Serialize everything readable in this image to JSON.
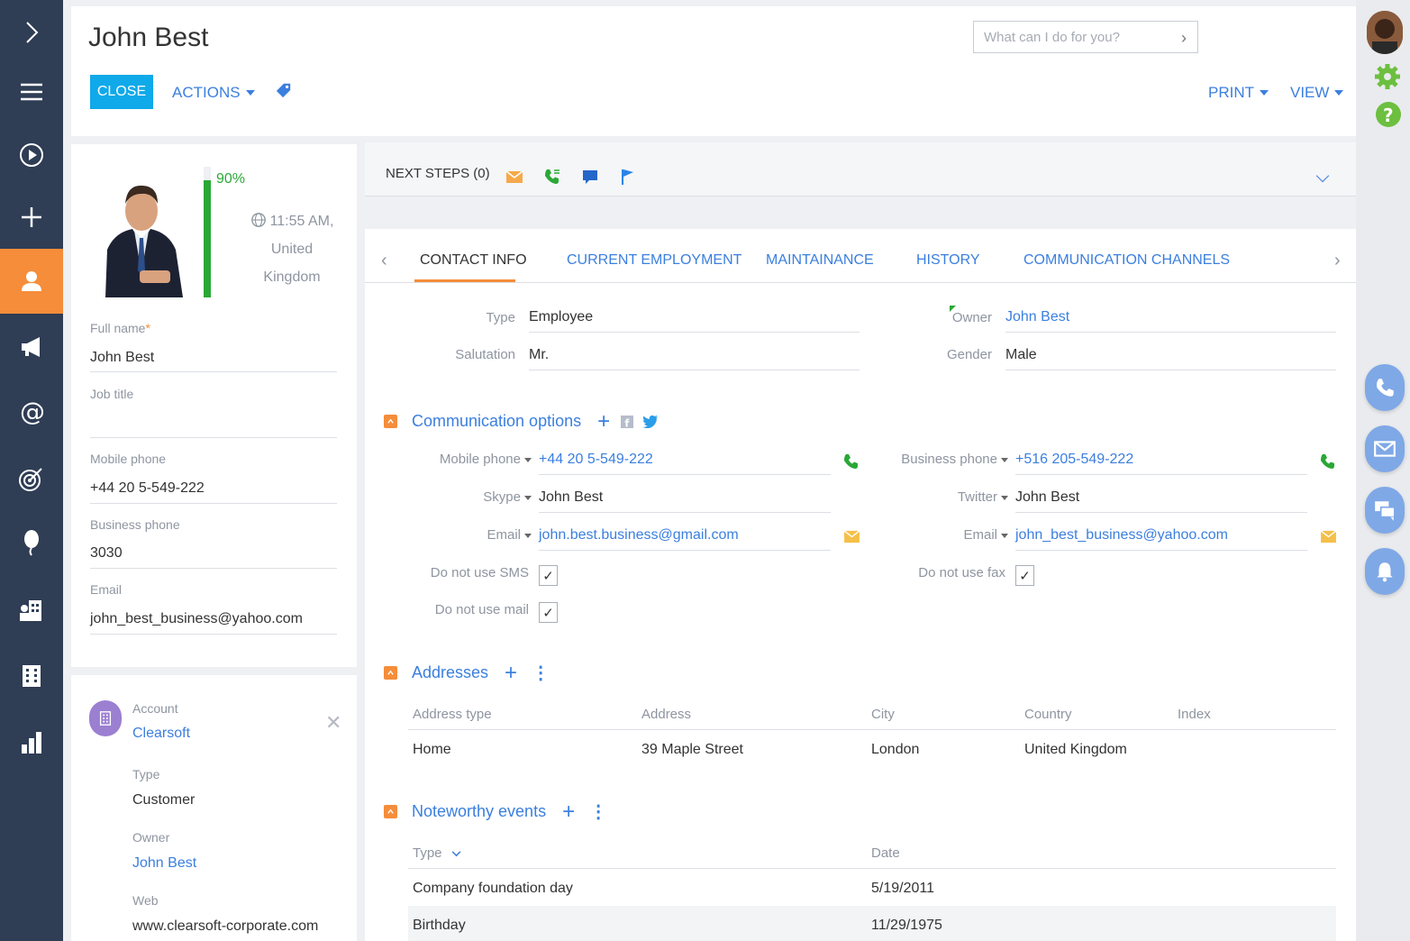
{
  "header": {
    "title": "John Best",
    "search_placeholder": "What can I do for you?",
    "close_label": "CLOSE",
    "actions_label": "ACTIONS",
    "print_label": "PRINT",
    "view_label": "VIEW"
  },
  "profile": {
    "completeness_value": 90,
    "completeness_label": "90%",
    "time_line1": "11:55 AM,",
    "time_line2": "United",
    "time_line3": "Kingdom",
    "full_name_label": "Full name",
    "full_name_required": "*",
    "full_name": "John Best",
    "job_title_label": "Job title",
    "job_title": "",
    "mobile_phone_label": "Mobile phone",
    "mobile_phone": "+44 20 5-549-222",
    "business_phone_label": "Business phone",
    "business_phone": "3030",
    "email_label": "Email",
    "email": "john_best_business@yahoo.com"
  },
  "account": {
    "account_label": "Account",
    "account_name": "Clearsoft",
    "type_label": "Type",
    "type": "Customer",
    "owner_label": "Owner",
    "owner": "John Best",
    "web_label": "Web",
    "web": "www.clearsoft-corporate.com"
  },
  "next_steps": {
    "label": "NEXT STEPS (0)"
  },
  "tabs": [
    {
      "label": "CONTACT INFO"
    },
    {
      "label": "CURRENT EMPLOYMENT"
    },
    {
      "label": "MAINTAINANCE"
    },
    {
      "label": "HISTORY"
    },
    {
      "label": "COMMUNICATION CHANNELS"
    }
  ],
  "contact_info": {
    "type_label": "Type",
    "type": "Employee",
    "salutation_label": "Salutation",
    "salutation": "Mr.",
    "owner_label": "Owner",
    "owner": "John Best",
    "gender_label": "Gender",
    "gender": "Male"
  },
  "communication": {
    "title": "Communication options",
    "mobile_label": "Mobile phone",
    "mobile": "+44 20 5-549-222",
    "skype_label": "Skype",
    "skype": "John Best",
    "email1_label": "Email",
    "email1": "john.best.business@gmail.com",
    "business_label": "Business phone",
    "business": "+516 205-549-222",
    "twitter_label": "Twitter",
    "twitter": "John Best",
    "email2_label": "Email",
    "email2": "john_best_business@yahoo.com",
    "no_sms_label": "Do not use SMS",
    "no_sms": true,
    "no_fax_label": "Do not use fax",
    "no_fax": true,
    "no_mail_label": "Do not use mail",
    "no_mail": true
  },
  "addresses": {
    "title": "Addresses",
    "columns": [
      "Address type",
      "Address",
      "City",
      "Country",
      "Index"
    ],
    "rows": [
      [
        "Home",
        "39 Maple Street",
        "London",
        "United Kingdom",
        ""
      ]
    ]
  },
  "events": {
    "title": "Noteworthy events",
    "columns": [
      "Type",
      "Date"
    ],
    "rows": [
      [
        "Company foundation day",
        "5/19/2011"
      ],
      [
        "Birthday",
        "11/29/1975"
      ]
    ]
  },
  "colors": {
    "sidebar": "#2f3d55",
    "accent_orange": "#f58d3a",
    "link_blue": "#3b7fdf",
    "close_blue": "#10a9e9",
    "progress_green": "#2aa836"
  },
  "icons": {
    "sidebar": [
      "expand-icon",
      "menu-icon",
      "play-icon",
      "add-icon",
      "contact-icon",
      "campaign-icon",
      "email-icon",
      "target-icon",
      "idea-icon",
      "accounts-icon",
      "building-icon",
      "dashboard-icon"
    ],
    "right": [
      "user-avatar",
      "settings-icon",
      "help-icon",
      "phone-icon",
      "mail-icon",
      "chat-icon",
      "notification-icon"
    ]
  }
}
